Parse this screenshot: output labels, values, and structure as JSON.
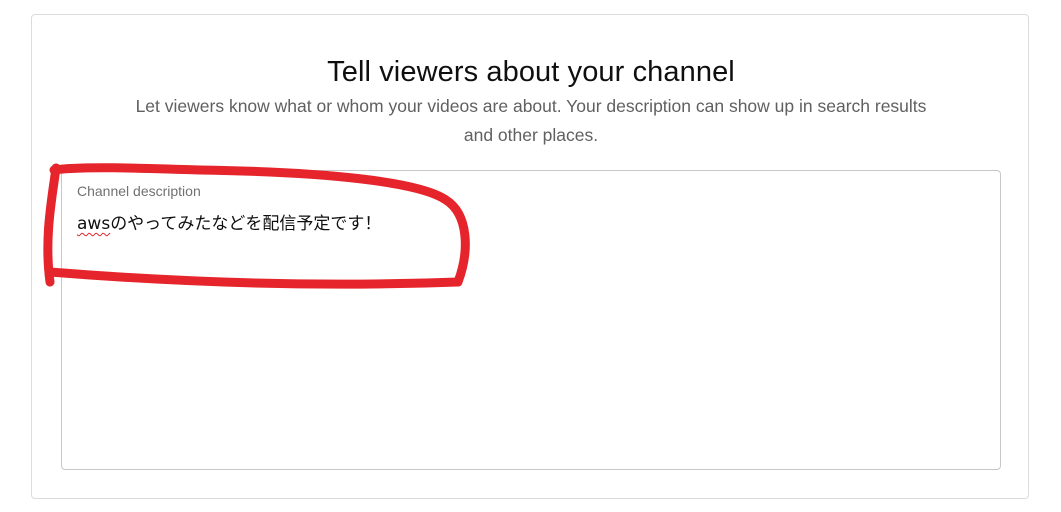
{
  "header": {
    "title": "Tell viewers about your channel",
    "subtitle": "Let viewers know what or whom your videos are about. Your description can show up in search results and other places."
  },
  "description_field": {
    "label": "Channel description",
    "value_misspelled_part": "aws",
    "value_rest": "のやってみたなどを配信予定です！"
  },
  "annotation": {
    "color": "#e5252b"
  }
}
